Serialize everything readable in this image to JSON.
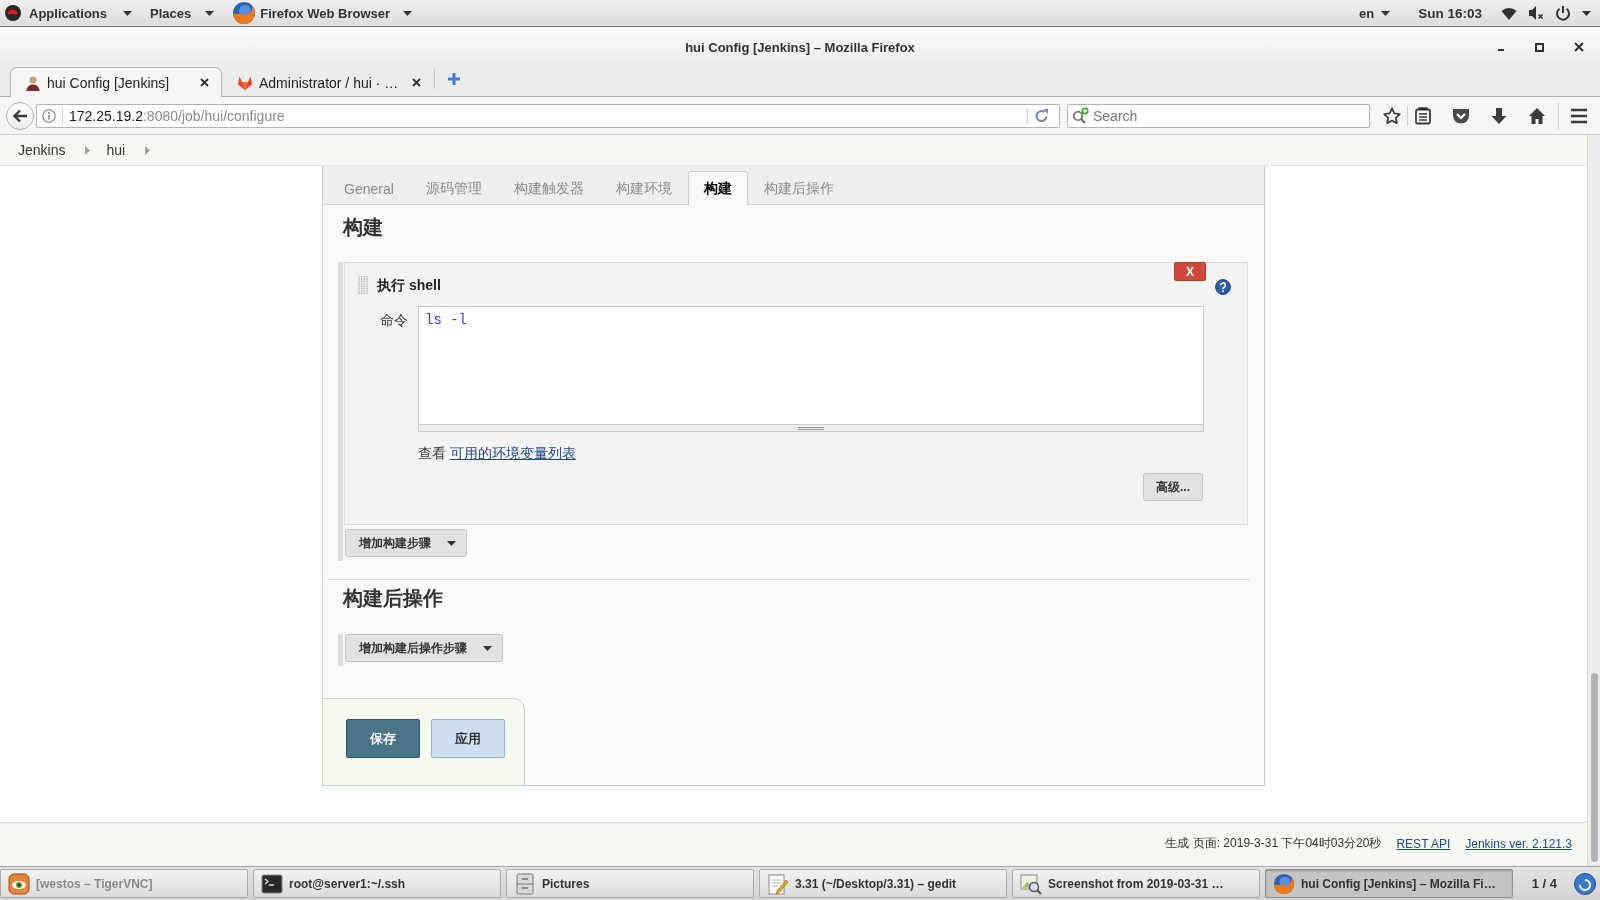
{
  "top_bar": {
    "menus": [
      {
        "kind": "system",
        "label": "Applications"
      },
      {
        "kind": "places",
        "label": "Places"
      },
      {
        "kind": "app",
        "label": "Firefox Web Browser"
      }
    ],
    "language": "en",
    "clock": "Sun 16:03"
  },
  "window": {
    "title": "hui Config [Jenkins] – Mozilla Firefox"
  },
  "browser_tabs": [
    {
      "kind": "avatar",
      "title": "hui Config [Jenkins]",
      "selected": true
    },
    {
      "kind": "fox",
      "title": "Administrator / hui · …",
      "selected": false
    }
  ],
  "address_bar": {
    "host": "172.25.19.2",
    "path": ":8080/job/hui/configure"
  },
  "search": {
    "placeholder": "Search"
  },
  "breadcrumbs": [
    "Jenkins",
    "hui"
  ],
  "config_tabs": [
    {
      "label": "General",
      "selected": false
    },
    {
      "label": "源码管理",
      "selected": false
    },
    {
      "label": "构建触发器",
      "selected": false
    },
    {
      "label": "构建环境",
      "selected": false
    },
    {
      "label": "构建",
      "selected": true
    },
    {
      "label": "构建后操作",
      "selected": false
    }
  ],
  "build": {
    "title": "构建",
    "step": {
      "title": "执行 shell",
      "delete": "X",
      "command_label": "命令",
      "command": "ls -l",
      "hint": "查看",
      "hint_link": "可用的环境变量列表",
      "advanced": "高级..."
    },
    "add_step": "增加构建步骤"
  },
  "post_build": {
    "title": "构建后操作",
    "add_step": "增加构建后操作步骤"
  },
  "actions": [
    {
      "kind": "primary",
      "label": "保存"
    },
    {
      "kind": "secondary",
      "label": "应用"
    }
  ],
  "footer": {
    "generated": "生成 页面: 2019-3-31 下午04时03分20秒",
    "links": [
      "REST API",
      "Jenkins ver. 2.121.3"
    ]
  },
  "taskbar": {
    "items": [
      {
        "kind": "vnc",
        "label": "[westos – TigerVNC]",
        "minimized": true,
        "selected": false
      },
      {
        "kind": "terminal",
        "label": "root@server1:~/.ssh",
        "minimized": false,
        "selected": false
      },
      {
        "kind": "files",
        "label": "Pictures",
        "minimized": false,
        "selected": false
      },
      {
        "kind": "editor",
        "label": "3.31 (~/Desktop/3.31) – gedit",
        "minimized": false,
        "selected": false
      },
      {
        "kind": "viewer",
        "label": "Screenshot from 2019-03-31 …",
        "minimized": false,
        "selected": false
      },
      {
        "kind": "browser",
        "label": "hui Config [Jenkins] – Mozilla Fi…",
        "minimized": false,
        "selected": true
      }
    ],
    "workspace": "1 / 4"
  }
}
